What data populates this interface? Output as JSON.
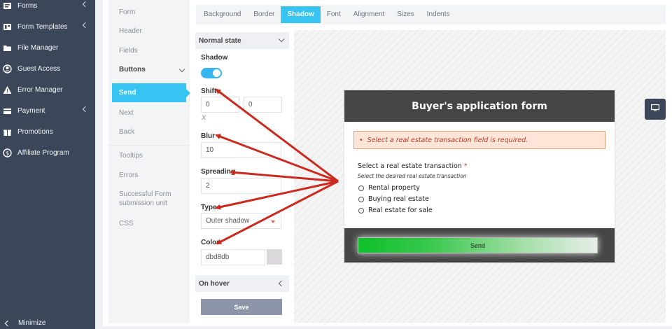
{
  "sidebar": {
    "items": [
      {
        "label": "Forms",
        "icon": "forms-icon",
        "chevron": true
      },
      {
        "label": "Form Templates",
        "icon": "templates-icon",
        "chevron": true
      },
      {
        "label": "File Manager",
        "icon": "folder-icon",
        "chevron": false
      },
      {
        "label": "Guest Access",
        "icon": "user-circle-icon",
        "chevron": false
      },
      {
        "label": "Error Manager",
        "icon": "warning-icon",
        "chevron": false
      },
      {
        "label": "Payment",
        "icon": "payment-icon",
        "chevron": true
      },
      {
        "label": "Promotions",
        "icon": "gift-icon",
        "chevron": false
      },
      {
        "label": "Affiliate Program",
        "icon": "dollar-icon",
        "chevron": false
      }
    ],
    "minimize": "Minimize"
  },
  "subnav": {
    "form": "Form",
    "header": "Header",
    "fields": "Fields",
    "buttons": "Buttons",
    "send": "Send",
    "next": "Next",
    "back": "Back",
    "tooltips": "Tooltips",
    "errors": "Errors",
    "successful": "Successful Form submission unit",
    "css": "CSS"
  },
  "tabs": [
    "Background",
    "Border",
    "Shadow",
    "Font",
    "Alignment",
    "Sizes",
    "Indents"
  ],
  "active_tab": "Shadow",
  "settings": {
    "normal_state": "Normal state",
    "shadow_label": "Shadow",
    "shadow_on": true,
    "shift_label": "Shift",
    "shift_x": "0",
    "shift_y": "0",
    "shift_x_note": "X",
    "blur_label": "Blur",
    "blur_value": "10",
    "spreading_label": "Spreading",
    "spreading_value": "2",
    "type_label": "Type",
    "type_value": "Outer shadow",
    "color_label": "Color",
    "color_value": "dbd8db",
    "on_hover": "On hover",
    "save": "Save"
  },
  "preview": {
    "title": "Buyer's application form",
    "error": "Select a real estate transaction field is required.",
    "question": "Select a real estate transaction",
    "required_mark": "*",
    "hint": "Select the desired real estate transaction",
    "options": [
      "Rental property",
      "Buying real estate",
      "Real estate for sale"
    ],
    "send_label": "Send"
  },
  "colors": {
    "accent": "#38c4f2",
    "sidebar": "#3c4659",
    "arrow": "#cc2a1e",
    "shadow": "#dbd8db"
  }
}
